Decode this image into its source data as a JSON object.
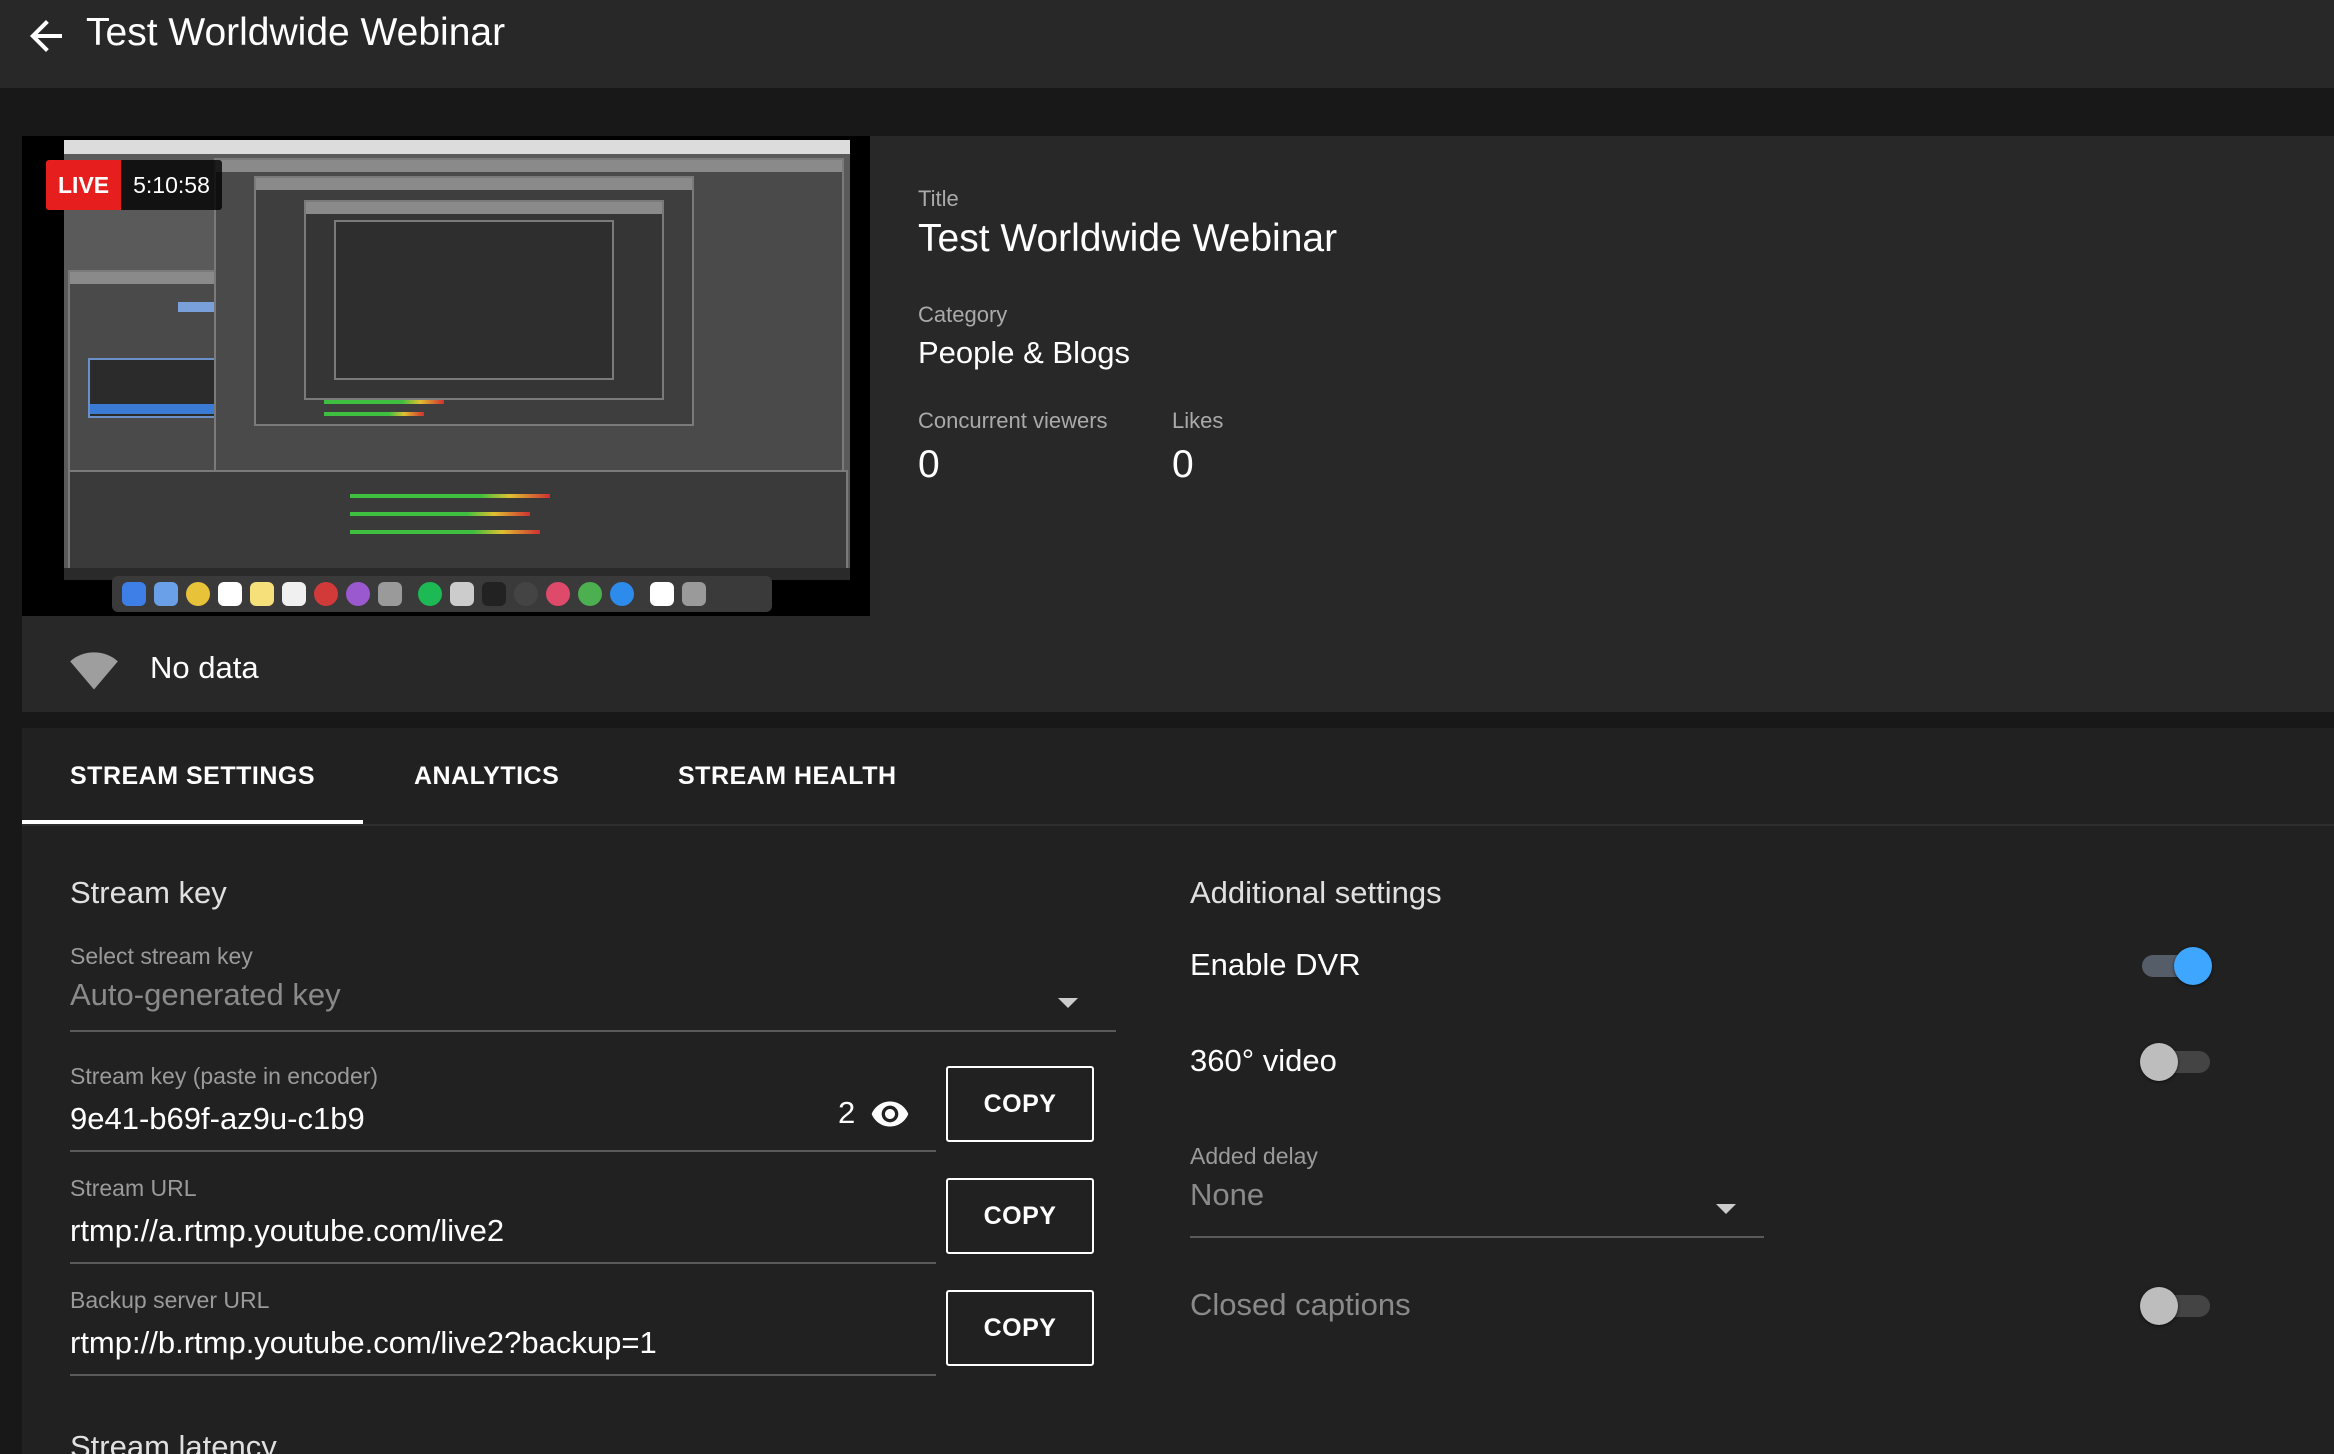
{
  "header": {
    "title": "Test Worldwide Webinar",
    "back_icon": "arrow-left-icon"
  },
  "preview": {
    "live_label": "LIVE",
    "elapsed": "5:10:58",
    "title_label": "Title",
    "title_value": "Test Worldwide Webinar",
    "category_label": "Category",
    "category_value": "People & Blogs",
    "viewers_label": "Concurrent viewers",
    "viewers_value": "0",
    "likes_label": "Likes",
    "likes_value": "0",
    "connection_icon": "wifi-signal-icon",
    "connection_status": "No data"
  },
  "tabs": [
    {
      "label": "STREAM SETTINGS",
      "active": true
    },
    {
      "label": "ANALYTICS",
      "active": false
    },
    {
      "label": "STREAM HEALTH",
      "active": false
    }
  ],
  "stream_key": {
    "section_title": "Stream key",
    "select_label": "Select stream key",
    "select_value": "Auto-generated key",
    "key_label": "Stream key (paste in encoder)",
    "key_value": "9e41-b69f-az9u-c1b9",
    "key_counter": "2",
    "reveal_icon": "eye-icon",
    "url_label": "Stream URL",
    "url_value": "rtmp://a.rtmp.youtube.com/live2",
    "backup_label": "Backup server URL",
    "backup_value": "rtmp://b.rtmp.youtube.com/live2?backup=1",
    "copy_label": "COPY",
    "next_section_title": "Stream latency"
  },
  "additional": {
    "section_title": "Additional settings",
    "dvr_label": "Enable DVR",
    "dvr_enabled": true,
    "video360_label": "360° video",
    "video360_enabled": false,
    "delay_label": "Added delay",
    "delay_value": "None",
    "captions_label": "Closed captions",
    "captions_enabled": false
  },
  "colors": {
    "accent": "#3ea6ff",
    "live_red": "#e61e1e",
    "panel": "#282828",
    "background": "#181818"
  }
}
